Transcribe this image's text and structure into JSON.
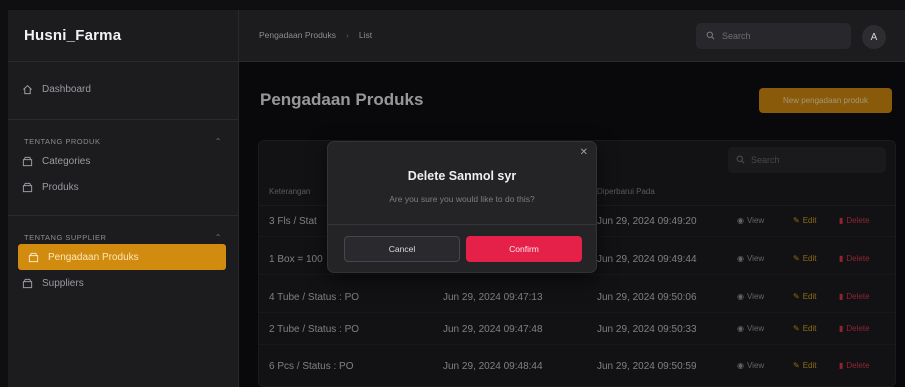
{
  "app": {
    "brand": "Husni_Farma"
  },
  "colors": {
    "accent": "#d18b0f",
    "danger": "#e52149",
    "edit": "#d9a520"
  },
  "sidebar": {
    "dashboard": {
      "label": "Dashboard",
      "icon": "home-icon"
    },
    "groups": [
      {
        "label": "TENTANG PRODUK",
        "items": [
          {
            "label": "Categories",
            "icon": "box-icon"
          },
          {
            "label": "Produks",
            "icon": "box-icon"
          }
        ]
      },
      {
        "label": "TENTANG SUPPLIER",
        "items": [
          {
            "label": "Pengadaan Produks",
            "icon": "box-icon",
            "active": true
          },
          {
            "label": "Suppliers",
            "icon": "box-icon"
          }
        ]
      }
    ]
  },
  "topbar": {
    "breadcrumbs": [
      "Pengadaan Produks",
      "List"
    ],
    "search_placeholder": "Search",
    "avatar_initial": "A"
  },
  "main": {
    "title": "Pengadaan Produks",
    "new_button": "New pengadaan produk",
    "table_search_placeholder": "Search",
    "columns": {
      "keterangan": "Keterangan",
      "diperbarui": "Diperbarui Pada"
    },
    "rows": [
      {
        "keterangan": "3 Fls / Stat",
        "dibuat": "",
        "diperbarui": "Jun 29, 2024 09:49:20"
      },
      {
        "keterangan": "1 Box = 100",
        "dibuat": "",
        "diperbarui": "Jun 29, 2024 09:49:44"
      },
      {
        "keterangan": "4 Tube / Status : PO",
        "dibuat": "Jun 29, 2024 09:47:13",
        "diperbarui": "Jun 29, 2024 09:50:06"
      },
      {
        "keterangan": "2 Tube / Status : PO",
        "dibuat": "Jun 29, 2024 09:47:48",
        "diperbarui": "Jun 29, 2024 09:50:33"
      },
      {
        "keterangan": "6 Pcs / Status : PO",
        "dibuat": "Jun 29, 2024 09:48:44",
        "diperbarui": "Jun 29, 2024 09:50:59"
      }
    ],
    "actions": {
      "view": "View",
      "edit": "Edit",
      "delete": "Delete"
    }
  },
  "modal": {
    "title": "Delete Sanmol syr",
    "message": "Are you sure you would like to do this?",
    "cancel": "Cancel",
    "confirm": "Confirm",
    "close_icon": "close-icon"
  }
}
